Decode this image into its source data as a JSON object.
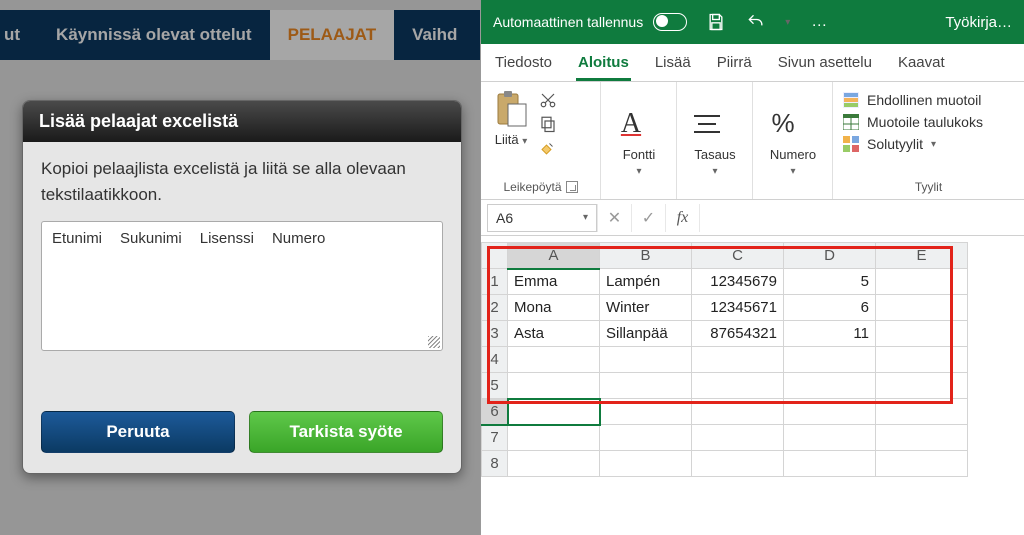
{
  "left": {
    "tabs": {
      "cut": "ut",
      "ongoing": "Käynnissä olevat ottelut",
      "players": "PELAAJAT",
      "subs": "Vaihd"
    },
    "dialog": {
      "title": "Lisää pelaajat excelistä",
      "instruction": "Kopioi pelaajlista excelistä ja liitä se alla olevaan tekstilaatikkoon.",
      "placeholder": {
        "first": "Etunimi",
        "last": "Sukunimi",
        "license": "Lisenssi",
        "number": "Numero"
      },
      "cancel": "Peruuta",
      "check": "Tarkista syöte"
    }
  },
  "excel": {
    "titlebar": {
      "autosave": "Automaattinen tallennus",
      "doc": "Työkirja…",
      "ellipsis": "…"
    },
    "tabs": {
      "file": "Tiedosto",
      "home": "Aloitus",
      "insert": "Lisää",
      "draw": "Piirrä",
      "layout": "Sivun asettelu",
      "formulas": "Kaavat"
    },
    "groups": {
      "clipboard": {
        "paste": "Liitä",
        "label": "Leikepöytä"
      },
      "font": {
        "big": "Fontti"
      },
      "align": {
        "big": "Tasaus"
      },
      "number": {
        "big": "Numero"
      },
      "styles": {
        "cond": "Ehdollinen muotoil",
        "table": "Muotoile taulukoks",
        "cell": "Solutyylit",
        "label": "Tyylit"
      }
    },
    "namebox": "A6",
    "fx": "fx",
    "cols": [
      "A",
      "B",
      "C",
      "D",
      "E"
    ],
    "rows": [
      {
        "n": "1",
        "a": "Emma",
        "b": "Lampén",
        "c": "12345679",
        "d": "5"
      },
      {
        "n": "2",
        "a": "Mona",
        "b": "Winter",
        "c": "12345671",
        "d": "6"
      },
      {
        "n": "3",
        "a": "Asta",
        "b": "Sillanpää",
        "c": "87654321",
        "d": "11"
      },
      {
        "n": "4",
        "a": "",
        "b": "",
        "c": "",
        "d": ""
      },
      {
        "n": "5",
        "a": "",
        "b": "",
        "c": "",
        "d": ""
      },
      {
        "n": "6",
        "a": "",
        "b": "",
        "c": "",
        "d": ""
      },
      {
        "n": "7",
        "a": "",
        "b": "",
        "c": "",
        "d": ""
      },
      {
        "n": "8",
        "a": "",
        "b": "",
        "c": "",
        "d": ""
      }
    ]
  }
}
